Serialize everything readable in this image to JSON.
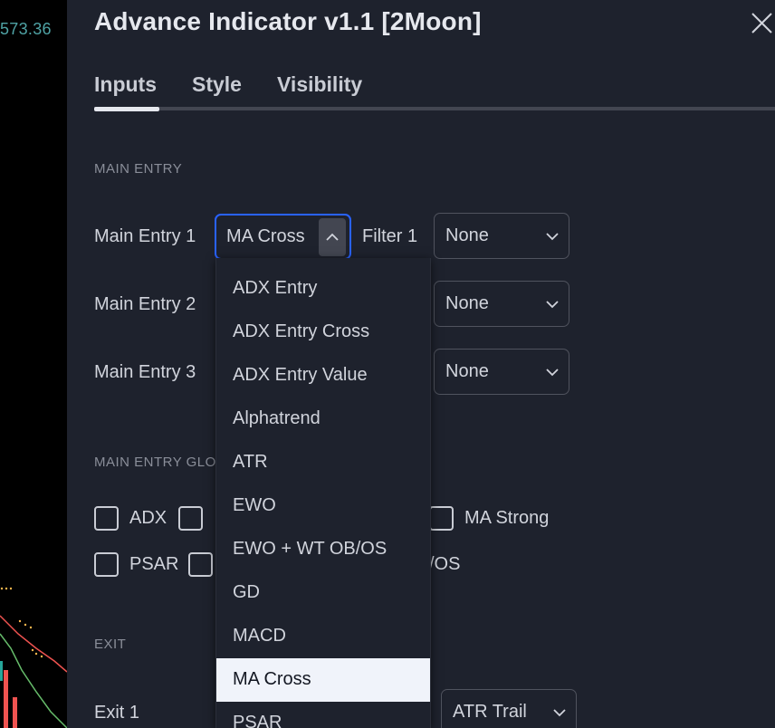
{
  "chart_bg": {
    "price_label": "573.36"
  },
  "dialog": {
    "title": "Advance Indicator v1.1 [2Moon]",
    "tabs": [
      {
        "label": "Inputs",
        "active": true
      },
      {
        "label": "Style",
        "active": false
      },
      {
        "label": "Visibility",
        "active": false
      }
    ],
    "sections": {
      "main_entry": "MAIN ENTRY",
      "main_entry_global": "MAIN ENTRY GLOBAL",
      "exit": "EXIT"
    },
    "rows": {
      "main_entry_1": {
        "label": "Main Entry 1",
        "value": "MA Cross"
      },
      "filter_1": {
        "label": "Filter 1",
        "value": "None"
      },
      "main_entry_2": {
        "label": "Main Entry 2",
        "filter_value": "None"
      },
      "main_entry_3": {
        "label": "Main Entry 3",
        "filter_value": "None"
      },
      "exit_1": {
        "label": "Exit 1",
        "value": "ATR Trail"
      }
    },
    "checkboxes": {
      "adx": "ADX",
      "ma_strong": "MA Strong",
      "psar": "PSAR",
      "ob_os_suffix": "/OS"
    },
    "dropdown": {
      "options": [
        "ADX Entry",
        "ADX Entry Cross",
        "ADX Entry Value",
        "Alphatrend",
        "ATR",
        "EWO",
        "EWO + WT OB/OS",
        "GD",
        "MACD",
        "MA Cross",
        "PSAR"
      ],
      "selected": "MA Cross"
    }
  },
  "colors": {
    "dialog_bg": "#1e222d",
    "accent_focus": "#2962ff",
    "price_text": "#4fa3a5",
    "selected_option_bg": "#f0f3fa"
  }
}
